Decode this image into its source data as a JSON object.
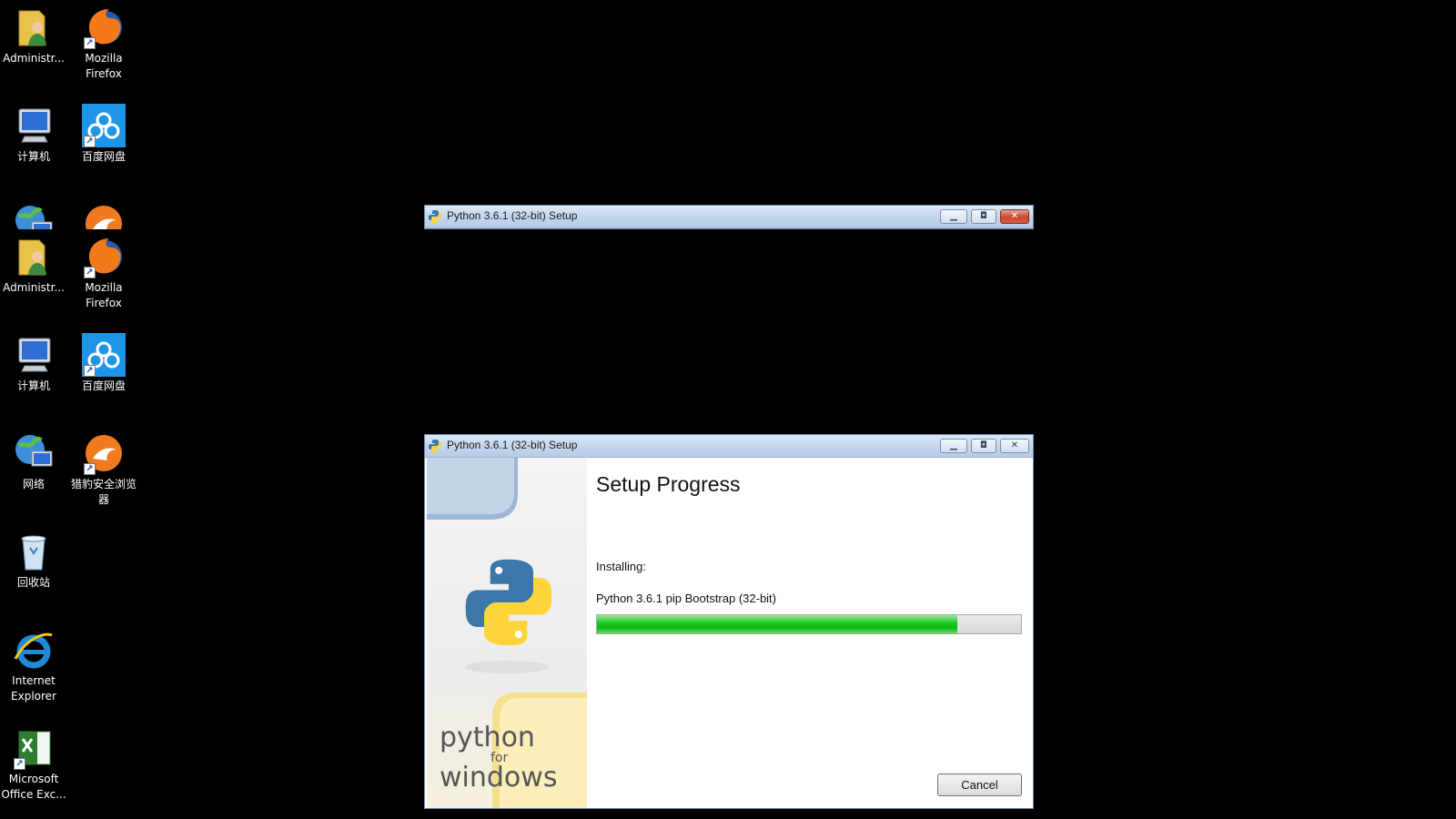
{
  "desktop": {
    "icons_col1": [
      {
        "label": "Administr...",
        "icon": "user-folder-icon"
      },
      {
        "label": "计算机",
        "icon": "computer-icon"
      },
      {
        "label": "",
        "icon": "network-icon"
      },
      {
        "label": "Administr...",
        "icon": "user-folder-icon"
      },
      {
        "label": "计算机",
        "icon": "computer-icon"
      },
      {
        "label": "网络",
        "icon": "network-icon"
      },
      {
        "label": "回收站",
        "icon": "recycle-bin-icon"
      },
      {
        "label": "Internet Explorer",
        "icon": "internet-explorer-icon"
      },
      {
        "label": "Microsoft Office Exc...",
        "icon": "excel-icon"
      }
    ],
    "icons_col2": [
      {
        "label": "Mozilla Firefox",
        "icon": "firefox-icon"
      },
      {
        "label": "百度网盘",
        "icon": "baidu-netdisk-icon"
      },
      {
        "label": "",
        "icon": "liebao-browser-icon"
      },
      {
        "label": "Mozilla Firefox",
        "icon": "firefox-icon"
      },
      {
        "label": "百度网盘",
        "icon": "baidu-netdisk-icon"
      },
      {
        "label": "猎豹安全浏览器",
        "icon": "liebao-browser-icon"
      }
    ]
  },
  "window_top": {
    "title": "Python 3.6.1 (32-bit) Setup",
    "min_glyph": "▁",
    "max_glyph": "◘",
    "close_glyph": "✕"
  },
  "window_main": {
    "title": "Python 3.6.1 (32-bit) Setup",
    "min_glyph": "▁",
    "max_glyph": "◘",
    "close_glyph": "✕",
    "heading": "Setup Progress",
    "installing_label": "Installing:",
    "current_item": "Python 3.6.1 pip Bootstrap (32-bit)",
    "progress_fraction": 0.85,
    "cancel_label": "Cancel",
    "brand": {
      "line1": "python",
      "line2": "for",
      "line3": "windows"
    }
  },
  "colors": {
    "progress_green": "#19c81c",
    "python_blue": "#3b77a8",
    "python_yellow": "#ffd43b"
  }
}
